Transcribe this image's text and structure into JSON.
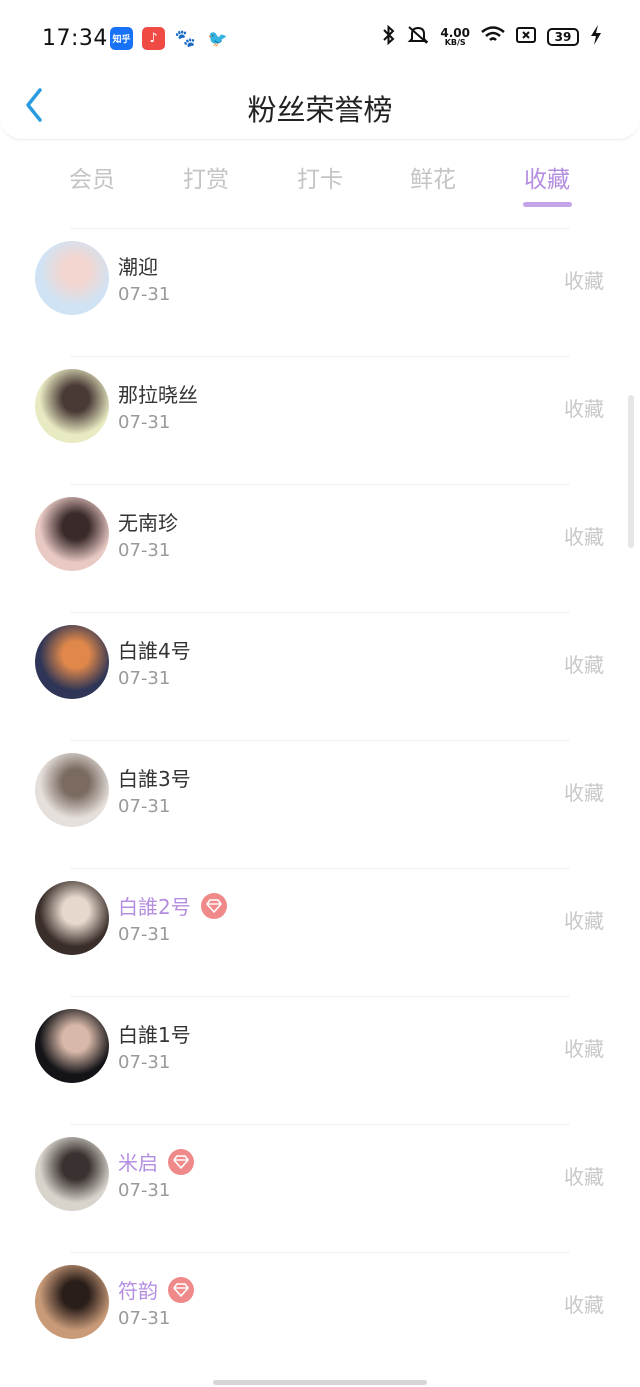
{
  "status_bar": {
    "time": "17:34",
    "apps": [
      {
        "name": "zhihu",
        "label": "知乎"
      },
      {
        "name": "music",
        "label": "♪"
      },
      {
        "name": "baidu",
        "label": "🐾"
      },
      {
        "name": "bird",
        "label": "🐦"
      }
    ],
    "net_speed_value": "4.00",
    "net_speed_unit": "KB/S",
    "battery": "39"
  },
  "header": {
    "title": "粉丝荣誉榜"
  },
  "tabs": [
    {
      "label": "会员",
      "active": false
    },
    {
      "label": "打赏",
      "active": false
    },
    {
      "label": "打卡",
      "active": false
    },
    {
      "label": "鲜花",
      "active": false
    },
    {
      "label": "收藏",
      "active": true
    }
  ],
  "fans": [
    {
      "name": "潮迎",
      "date": "07-31",
      "action": "收藏",
      "vip": false,
      "avatar_colors": [
        "#cfe3f5",
        "#f3d6cf"
      ]
    },
    {
      "name": "那拉晓丝",
      "date": "07-31",
      "action": "收藏",
      "vip": false,
      "avatar_colors": [
        "#e8eac2",
        "#4a3a36"
      ]
    },
    {
      "name": "无南珍",
      "date": "07-31",
      "action": "收藏",
      "vip": false,
      "avatar_colors": [
        "#e9c9c4",
        "#3a2a2a"
      ]
    },
    {
      "name": "白誰4号",
      "date": "07-31",
      "action": "收藏",
      "vip": false,
      "avatar_colors": [
        "#2e3556",
        "#e0884a"
      ]
    },
    {
      "name": "白誰3号",
      "date": "07-31",
      "action": "收藏",
      "vip": false,
      "avatar_colors": [
        "#e6e0dc",
        "#7a6a60"
      ]
    },
    {
      "name": "白誰2号",
      "date": "07-31",
      "action": "收藏",
      "vip": true,
      "avatar_colors": [
        "#3a2e2a",
        "#e6d8cc"
      ]
    },
    {
      "name": "白誰1号",
      "date": "07-31",
      "action": "收藏",
      "vip": false,
      "avatar_colors": [
        "#141418",
        "#d8b8a8"
      ]
    },
    {
      "name": "米启",
      "date": "07-31",
      "action": "收藏",
      "vip": true,
      "avatar_colors": [
        "#d8d4cc",
        "#3a3230"
      ]
    },
    {
      "name": "符韵",
      "date": "07-31",
      "action": "收藏",
      "vip": true,
      "avatar_colors": [
        "#c89a78",
        "#2a1e1a"
      ]
    }
  ],
  "colors": {
    "accent": "#b48ee0",
    "back_arrow": "#2a9be0",
    "vip_badge": "#f08a8a",
    "muted": "#c8c8c8"
  }
}
